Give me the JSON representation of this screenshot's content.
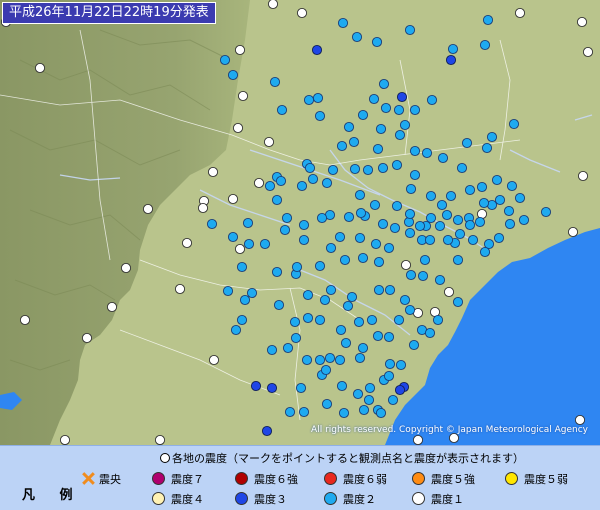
{
  "title": "平成26年11月22日22時19分発表",
  "copyright": "All rights reserved. Copyright © Japan Meteorological Agency",
  "legend": {
    "title": "凡 例",
    "header": "各地の震度（マークをポイントすると観測点名と震度が表示されます）",
    "epicenter_label": "震央",
    "items": [
      {
        "label": "震度７",
        "color": "#b0006e"
      },
      {
        "label": "震度６強",
        "color": "#b00000"
      },
      {
        "label": "震度６弱",
        "color": "#e8281e"
      },
      {
        "label": "震度５強",
        "color": "#ff8c14"
      },
      {
        "label": "震度５弱",
        "color": "#ffe600"
      },
      {
        "label": "震度４",
        "color": "#fff2b4"
      },
      {
        "label": "震度３",
        "color": "#1e46e6"
      },
      {
        "label": "震度２",
        "color": "#1eaaf0"
      },
      {
        "label": "震度１",
        "color": "#ffffff"
      }
    ]
  },
  "colors": {
    "mountain": "#8f9d6a",
    "lowland": "#b9c48c",
    "sea": "#2f86f2",
    "legend_bg": "#bcd3f6",
    "title_bg": "#3b3bb0"
  },
  "stations": {
    "int1": [
      [
        6,
        22
      ],
      [
        40,
        68
      ],
      [
        273,
        4
      ],
      [
        302,
        13
      ],
      [
        240,
        50
      ],
      [
        243,
        96
      ],
      [
        238,
        128
      ],
      [
        269,
        142
      ],
      [
        213,
        172
      ],
      [
        259,
        183
      ],
      [
        233,
        199
      ],
      [
        204,
        201
      ],
      [
        203,
        208
      ],
      [
        148,
        209
      ],
      [
        187,
        243
      ],
      [
        240,
        249
      ],
      [
        126,
        268
      ],
      [
        180,
        289
      ],
      [
        112,
        307
      ],
      [
        25,
        320
      ],
      [
        87,
        338
      ],
      [
        214,
        360
      ],
      [
        65,
        440
      ],
      [
        149,
        454
      ],
      [
        520,
        13
      ],
      [
        582,
        22
      ],
      [
        588,
        52
      ],
      [
        583,
        176
      ],
      [
        573,
        232
      ],
      [
        449,
        292
      ],
      [
        435,
        312
      ],
      [
        418,
        313
      ],
      [
        482,
        214
      ],
      [
        406,
        265
      ],
      [
        418,
        440
      ],
      [
        454,
        438
      ],
      [
        580,
        420
      ],
      [
        160,
        440
      ]
    ],
    "int3": [
      [
        317,
        50
      ],
      [
        451,
        60
      ],
      [
        402,
        97
      ],
      [
        256,
        386
      ],
      [
        272,
        388
      ],
      [
        267,
        431
      ],
      [
        404,
        387
      ],
      [
        400,
        390
      ]
    ],
    "int2": [
      [
        343,
        23
      ],
      [
        410,
        30
      ],
      [
        357,
        37
      ],
      [
        377,
        42
      ],
      [
        488,
        20
      ],
      [
        485,
        45
      ],
      [
        453,
        49
      ],
      [
        225,
        60
      ],
      [
        275,
        82
      ],
      [
        384,
        84
      ],
      [
        233,
        75
      ],
      [
        318,
        98
      ],
      [
        309,
        100
      ],
      [
        432,
        100
      ],
      [
        399,
        110
      ],
      [
        386,
        108
      ],
      [
        374,
        99
      ],
      [
        415,
        110
      ],
      [
        320,
        116
      ],
      [
        282,
        110
      ],
      [
        363,
        115
      ],
      [
        405,
        125
      ],
      [
        349,
        127
      ],
      [
        400,
        135
      ],
      [
        381,
        129
      ],
      [
        467,
        143
      ],
      [
        462,
        168
      ],
      [
        443,
        158
      ],
      [
        427,
        153
      ],
      [
        415,
        151
      ],
      [
        487,
        148
      ],
      [
        492,
        137
      ],
      [
        514,
        124
      ],
      [
        378,
        149
      ],
      [
        354,
        142
      ],
      [
        342,
        146
      ],
      [
        307,
        164
      ],
      [
        310,
        168
      ],
      [
        277,
        177
      ],
      [
        270,
        186
      ],
      [
        281,
        181
      ],
      [
        302,
        186
      ],
      [
        313,
        179
      ],
      [
        333,
        170
      ],
      [
        327,
        183
      ],
      [
        355,
        169
      ],
      [
        368,
        170
      ],
      [
        383,
        168
      ],
      [
        397,
        165
      ],
      [
        415,
        175
      ],
      [
        411,
        189
      ],
      [
        431,
        196
      ],
      [
        451,
        196
      ],
      [
        470,
        190
      ],
      [
        482,
        187
      ],
      [
        497,
        180
      ],
      [
        512,
        186
      ],
      [
        520,
        198
      ],
      [
        492,
        205
      ],
      [
        509,
        211
      ],
      [
        510,
        224
      ],
      [
        524,
        220
      ],
      [
        546,
        212
      ],
      [
        499,
        238
      ],
      [
        489,
        244
      ],
      [
        473,
        240
      ],
      [
        485,
        252
      ],
      [
        460,
        234
      ],
      [
        455,
        243
      ],
      [
        469,
        218
      ],
      [
        447,
        215
      ],
      [
        442,
        205
      ],
      [
        431,
        218
      ],
      [
        426,
        226
      ],
      [
        422,
        240
      ],
      [
        409,
        222
      ],
      [
        397,
        206
      ],
      [
        410,
        214
      ],
      [
        395,
        228
      ],
      [
        389,
        248
      ],
      [
        376,
        244
      ],
      [
        365,
        216
      ],
      [
        375,
        205
      ],
      [
        360,
        195
      ],
      [
        360,
        238
      ],
      [
        363,
        258
      ],
      [
        379,
        262
      ],
      [
        383,
        224
      ],
      [
        361,
        213
      ],
      [
        349,
        217
      ],
      [
        330,
        215
      ],
      [
        322,
        218
      ],
      [
        304,
        225
      ],
      [
        285,
        230
      ],
      [
        277,
        200
      ],
      [
        287,
        218
      ],
      [
        265,
        244
      ],
      [
        249,
        244
      ],
      [
        233,
        237
      ],
      [
        212,
        224
      ],
      [
        248,
        223
      ],
      [
        277,
        272
      ],
      [
        296,
        274
      ],
      [
        297,
        267
      ],
      [
        320,
        266
      ],
      [
        331,
        248
      ],
      [
        304,
        240
      ],
      [
        340,
        237
      ],
      [
        345,
        260
      ],
      [
        331,
        290
      ],
      [
        308,
        295
      ],
      [
        325,
        300
      ],
      [
        352,
        297
      ],
      [
        348,
        306
      ],
      [
        379,
        290
      ],
      [
        390,
        290
      ],
      [
        405,
        300
      ],
      [
        410,
        310
      ],
      [
        399,
        320
      ],
      [
        389,
        337
      ],
      [
        378,
        336
      ],
      [
        372,
        320
      ],
      [
        359,
        322
      ],
      [
        341,
        330
      ],
      [
        346,
        343
      ],
      [
        363,
        348
      ],
      [
        360,
        358
      ],
      [
        340,
        360
      ],
      [
        330,
        358
      ],
      [
        320,
        360
      ],
      [
        307,
        360
      ],
      [
        295,
        322
      ],
      [
        296,
        338
      ],
      [
        272,
        350
      ],
      [
        288,
        348
      ],
      [
        301,
        388
      ],
      [
        322,
        375
      ],
      [
        326,
        370
      ],
      [
        342,
        386
      ],
      [
        358,
        394
      ],
      [
        370,
        388
      ],
      [
        369,
        400
      ],
      [
        378,
        410
      ],
      [
        381,
        413
      ],
      [
        393,
        400
      ],
      [
        384,
        380
      ],
      [
        401,
        365
      ],
      [
        390,
        364
      ],
      [
        389,
        376
      ],
      [
        364,
        410
      ],
      [
        344,
        413
      ],
      [
        327,
        404
      ],
      [
        304,
        412
      ],
      [
        290,
        412
      ],
      [
        242,
        320
      ],
      [
        236,
        330
      ],
      [
        245,
        300
      ],
      [
        228,
        291
      ],
      [
        252,
        293
      ],
      [
        279,
        305
      ],
      [
        308,
        318
      ],
      [
        320,
        320
      ],
      [
        242,
        267
      ],
      [
        420,
        226
      ],
      [
        410,
        233
      ],
      [
        430,
        240
      ],
      [
        448,
        240
      ],
      [
        458,
        220
      ],
      [
        500,
        200
      ],
      [
        484,
        203
      ],
      [
        480,
        222
      ],
      [
        470,
        225
      ],
      [
        440,
        226
      ],
      [
        425,
        260
      ],
      [
        440,
        280
      ],
      [
        458,
        260
      ],
      [
        458,
        302
      ],
      [
        438,
        320
      ],
      [
        422,
        330
      ],
      [
        414,
        345
      ],
      [
        430,
        333
      ],
      [
        411,
        275
      ],
      [
        423,
        276
      ]
    ]
  }
}
